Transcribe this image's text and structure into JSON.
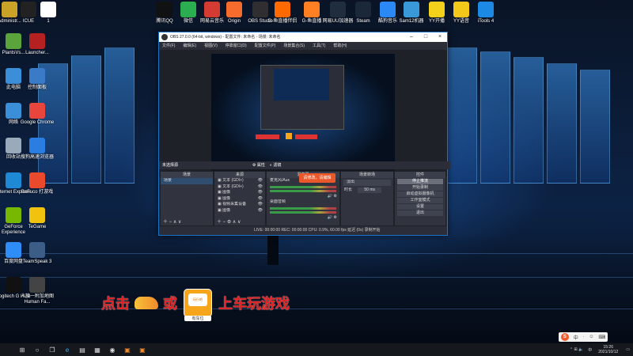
{
  "desktop_icons_top": [
    {
      "label": "Administr...",
      "icon": "user-folder-icon",
      "color": "#c9a227"
    },
    {
      "label": "ICUE",
      "icon": "icue-icon",
      "color": "#222222"
    },
    {
      "label": "1",
      "icon": "file-icon",
      "color": "#ffffff"
    },
    {
      "label": "腾讯QQ",
      "icon": "qq-icon",
      "color": "#111111"
    },
    {
      "label": "微信",
      "icon": "wechat-icon",
      "color": "#2aae4f"
    },
    {
      "label": "网易云音乐",
      "icon": "netease-music-icon",
      "color": "#d43c33"
    },
    {
      "label": "Origin",
      "icon": "origin-icon",
      "color": "#f56c2d"
    },
    {
      "label": "OBS Studio",
      "icon": "obs-icon",
      "color": "#302e31"
    },
    {
      "label": "G-鱼直播伴侣",
      "icon": "g-stream-icon",
      "color": "#ff6a00"
    },
    {
      "label": "G-鱼直播",
      "icon": "g-live-icon",
      "color": "#ff7f22"
    },
    {
      "label": "网易UU加速器",
      "icon": "uu-icon",
      "color": "#1f2d3d"
    },
    {
      "label": "Steam",
      "icon": "steam-icon",
      "color": "#1b2838"
    },
    {
      "label": "酷狗音乐",
      "icon": "kugou-icon",
      "color": "#2a89f5"
    },
    {
      "label": "Sam12机器",
      "icon": "sam-icon",
      "color": "#3a9ad9"
    },
    {
      "label": "YY开播",
      "icon": "yy-icon",
      "color": "#f4d21b"
    },
    {
      "label": "YY语音",
      "icon": "yy-voice-icon",
      "color": "#f4c81b"
    },
    {
      "label": "iTools 4",
      "icon": "itools-icon",
      "color": "#1c8ae5"
    }
  ],
  "desktop_icons_left": [
    {
      "label": "PlantsVs...",
      "icon": "plants-icon",
      "color": "#5aa43b"
    },
    {
      "label": "Launcher...",
      "icon": "launcher-icon",
      "color": "#b52020"
    },
    {
      "label": "此电脑",
      "icon": "computer-icon",
      "color": "#3b8fd9"
    },
    {
      "label": "控制面板",
      "icon": "control-panel-icon",
      "color": "#3a7bc8"
    },
    {
      "label": "网络",
      "icon": "network-icon",
      "color": "#3b8fd9"
    },
    {
      "label": "Google Chrome",
      "icon": "chrome-icon",
      "color": "#e8453c"
    },
    {
      "label": "回收站",
      "icon": "recycle-bin-icon",
      "color": "#9ab"
    },
    {
      "label": "搜狗高速浏览器",
      "icon": "sogou-browser-icon",
      "color": "#2a7de1"
    },
    {
      "label": "Internet Explorer",
      "icon": "ie-icon",
      "color": "#1e8ad6"
    },
    {
      "label": "BoFuco 打游戏",
      "icon": "bofuco-icon",
      "color": "#e84a2b"
    },
    {
      "label": "GeForce Experience",
      "icon": "geforce-icon",
      "color": "#76b900"
    },
    {
      "label": "TeGame",
      "icon": "tegame-icon",
      "color": "#f1c30f"
    },
    {
      "label": "百度网盘",
      "icon": "baidu-pan-icon",
      "color": "#2f8df8"
    },
    {
      "label": "TeamSpeak 3",
      "icon": "teamspeak-icon",
      "color": "#3b5d88"
    },
    {
      "label": "Logitech G HUB",
      "icon": "logitech-icon",
      "color": "#111111"
    },
    {
      "label": "人族一附加地图 Human Fa...",
      "icon": "game-icon",
      "color": "#444444"
    }
  ],
  "obs": {
    "title": "OBS 27.0.0 (64-bit, windows) - 配置文件: 未命名 - 场景: 未命名",
    "menu": [
      "文件(F)",
      "编辑(E)",
      "视图(V)",
      "停靠窗口(D)",
      "配置文件(P)",
      "场景集合(S)",
      "工具(T)",
      "帮助(H)"
    ],
    "scene_label": "未选择源",
    "props_label": "属性",
    "filters_label": "滤镜",
    "docks": {
      "scenes": {
        "header": "场景",
        "items": [
          "场景"
        ]
      },
      "sources": {
        "header": "来源",
        "items": [
          "文本 (GDI+)",
          "文本 (GDI+)",
          "图像",
          "图像",
          "视频采集设备",
          "图像"
        ]
      },
      "mixer": {
        "header": "混音器",
        "items": [
          "麦克风/Aux",
          "桌面音频"
        ]
      },
      "transitions": {
        "header": "场景转场",
        "fade": "淡出",
        "duration_label": "时长",
        "duration": "50 ms"
      },
      "controls": {
        "header": "控件",
        "buttons": [
          "停止推流",
          "开始录制",
          "启动虚拟摄像机",
          "工作室模式",
          "设置",
          "退出"
        ]
      }
    },
    "tooltip": "请修改，请编辑",
    "status": "LIVE: 00:00:00    REC: 00:00:00    CPU: 0.9%, 60.00 fps    延迟 (0s)    录制开始"
  },
  "promo": {
    "text_left": "点击",
    "text_mid": "或",
    "text_right": "上车玩游戏",
    "badge_label": "有车位",
    "badge_inner": "玩行吧"
  },
  "taskbar": {
    "items": [
      "windows-start-icon",
      "search-icon",
      "task-view-icon",
      "edge-icon",
      "file-explorer-icon",
      "store-icon",
      "obs-icon",
      "g-stream-icon",
      "g-live-icon"
    ]
  },
  "tray": {
    "ime": "中",
    "time": "15:26",
    "date": "2021/10/12"
  },
  "sogou": {
    "items": [
      "S",
      "中",
      "·",
      "☺",
      "⌨"
    ]
  }
}
